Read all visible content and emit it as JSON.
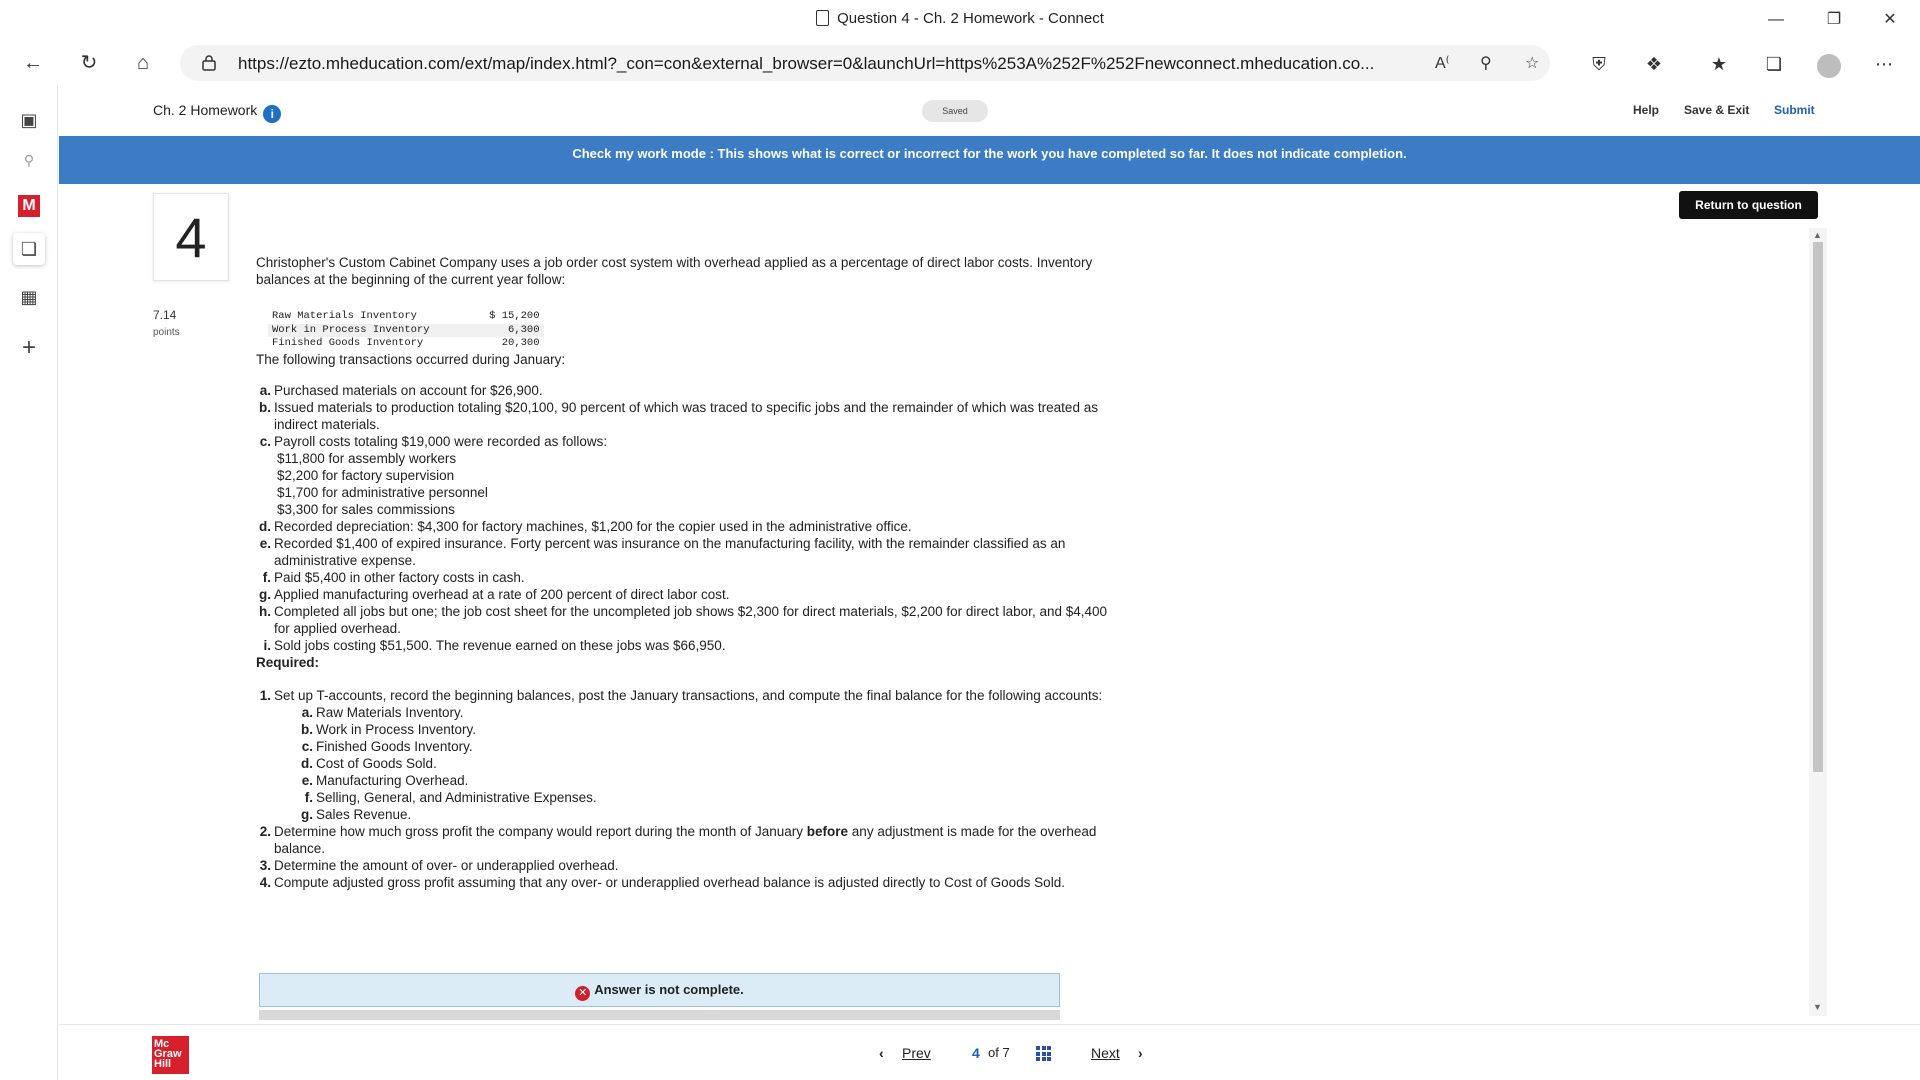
{
  "window": {
    "title": "Question 4 - Ch. 2 Homework - Connect",
    "url": "https://ezto.mheducation.com/ext/map/index.html?_con=con&external_browser=0&launchUrl=https%253A%252F%252Fnewconnect.mheducation.co..."
  },
  "header": {
    "assignment_title": "Ch. 2 Homework",
    "saved_label": "Saved",
    "help_label": "Help",
    "save_exit_label": "Save & Exit",
    "submit_label": "Submit"
  },
  "banner": {
    "text": "Check my work mode : This shows what is correct or incorrect for the work you have completed so far. It does not indicate completion."
  },
  "question": {
    "number": "4",
    "points_value": "7.14",
    "points_label": "points",
    "return_label": "Return to question",
    "intro": "Christopher's Custom Cabinet Company uses a job order cost system with overhead applied as a percentage of direct labor costs. Inventory balances at the beginning of the current year follow:",
    "inventory": [
      {
        "label": "Raw Materials Inventory",
        "value": "$ 15,200"
      },
      {
        "label": "Work in Process Inventory",
        "value": "6,300"
      },
      {
        "label": "Finished Goods Inventory",
        "value": "20,300"
      }
    ],
    "transactions_intro": "The following transactions occurred during January:",
    "transactions": [
      {
        "key": "a.",
        "text": "Purchased materials on account for $26,900."
      },
      {
        "key": "b.",
        "text": "Issued materials to production totaling $20,100, 90 percent of which was traced to specific jobs and the remainder of which was treated as indirect materials."
      },
      {
        "key": "c.",
        "text": "Payroll costs totaling $19,000 were recorded as follows:"
      },
      {
        "key": "d.",
        "text": "Recorded depreciation: $4,300 for factory machines, $1,200 for the copier used in the administrative office."
      },
      {
        "key": "e.",
        "text": "Recorded $1,400 of expired insurance. Forty percent was insurance on the manufacturing facility, with the remainder classified as an administrative expense."
      },
      {
        "key": "f.",
        "text": "Paid $5,400 in other factory costs in cash."
      },
      {
        "key": "g.",
        "text": "Applied manufacturing overhead at a rate of 200 percent of direct labor cost."
      },
      {
        "key": "h.",
        "text": "Completed all jobs but one; the job cost sheet for the uncompleted job shows $2,300 for direct materials, $2,200 for direct labor, and $4,400 for applied overhead."
      },
      {
        "key": "i.",
        "text": "Sold jobs costing $51,500. The revenue earned on these jobs was $66,950."
      }
    ],
    "payroll": [
      "$11,800 for assembly workers",
      "$2,200 for factory supervision",
      "$1,700 for administrative personnel",
      "$3,300 for sales commissions"
    ],
    "required_label": "Required:",
    "req1": "Set up T-accounts, record the beginning balances, post the January transactions, and compute the final balance for the following accounts:",
    "req1_items": [
      {
        "key": "a.",
        "text": "Raw Materials Inventory."
      },
      {
        "key": "b.",
        "text": "Work in Process Inventory."
      },
      {
        "key": "c.",
        "text": "Finished Goods Inventory."
      },
      {
        "key": "d.",
        "text": "Cost of Goods Sold."
      },
      {
        "key": "e.",
        "text": "Manufacturing Overhead."
      },
      {
        "key": "f.",
        "text": "Selling, General, and Administrative Expenses."
      },
      {
        "key": "g.",
        "text": "Sales Revenue."
      }
    ],
    "req2_a": "Determine how much gross profit the company would report during the month of January ",
    "req2_bold": "before",
    "req2_b": " any adjustment is made for the overhead balance.",
    "req3": "Determine the amount of over- or underapplied overhead.",
    "req4": "Compute adjusted gross profit assuming that any over- or underapplied overhead balance is adjusted directly to Cost of Goods Sold.",
    "req_keys": [
      "1.",
      "2.",
      "3.",
      "4."
    ],
    "answer_status": "Answer is not complete."
  },
  "footer": {
    "logo_lines": [
      "Mc",
      "Graw",
      "Hill"
    ],
    "prev_label": "Prev",
    "page_current": "4",
    "page_of": "of 7",
    "next_label": "Next"
  }
}
